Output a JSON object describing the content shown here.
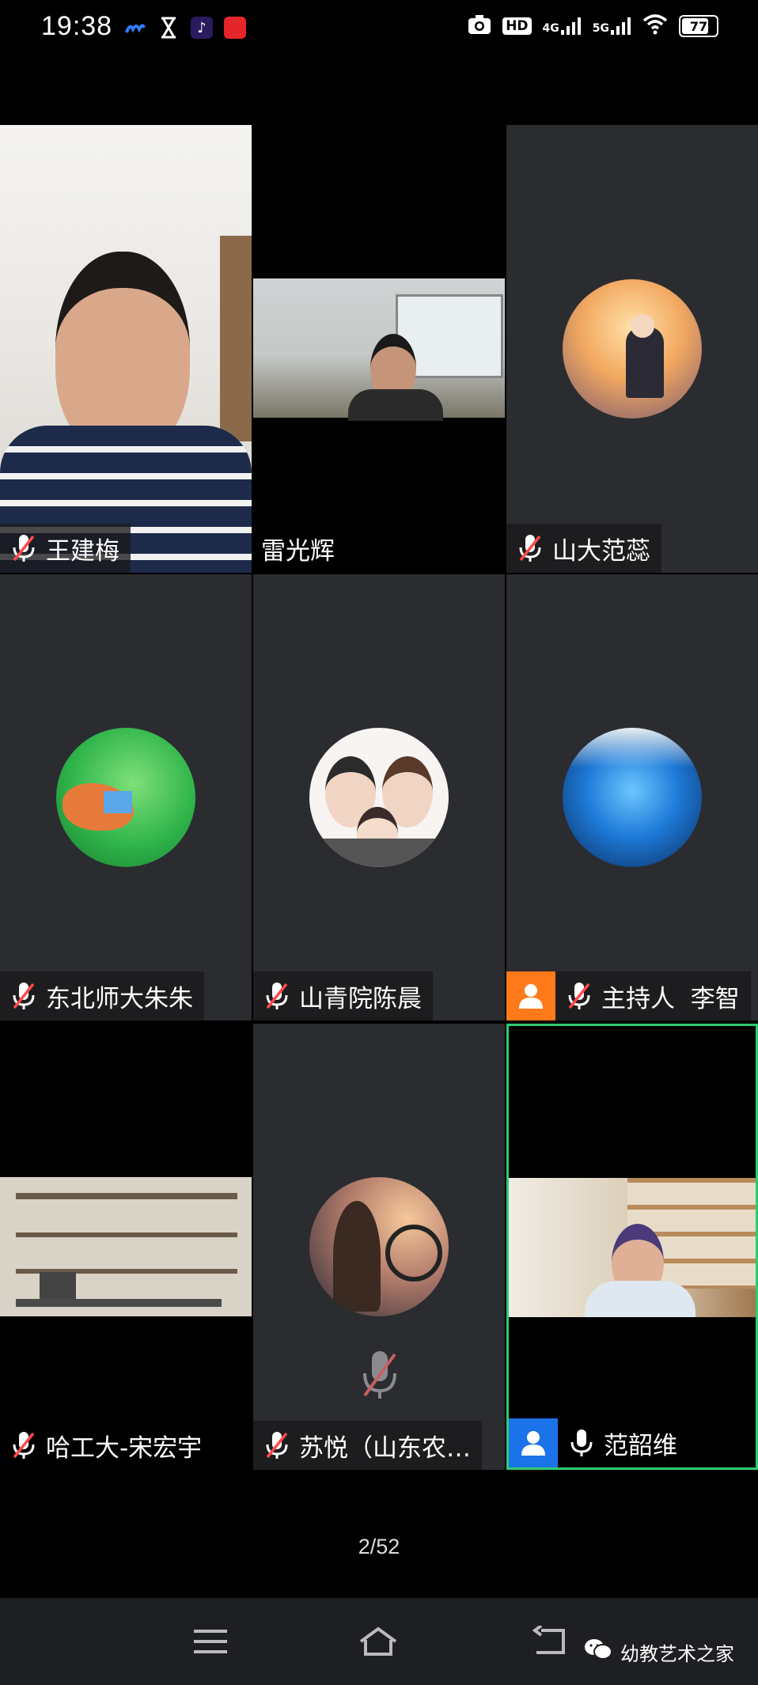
{
  "status_bar": {
    "time": "19:38",
    "hd_label": "HD",
    "net1": "4G",
    "net2": "5G",
    "battery": "77"
  },
  "participants": [
    {
      "name": "王建梅",
      "muted": true,
      "video": "camera"
    },
    {
      "name": "雷光辉",
      "muted": null,
      "video": "camera"
    },
    {
      "name": "山大范蕊",
      "muted": true,
      "video": "avatar"
    },
    {
      "name": "东北师大朱朱",
      "muted": true,
      "video": "avatar"
    },
    {
      "name": "山青院陈晨",
      "muted": true,
      "video": "avatar"
    },
    {
      "name": "主持人  李智",
      "muted": true,
      "video": "avatar",
      "host": true
    },
    {
      "name": "哈工大-宋宏宇",
      "muted": true,
      "video": "camera"
    },
    {
      "name": "苏悦（山东农…",
      "muted": true,
      "video": "avatar"
    },
    {
      "name": "范韶维",
      "muted": false,
      "video": "camera",
      "active_speaker": true
    }
  ],
  "pager": "2/52",
  "watermark": "幼教艺术之家",
  "colors": {
    "tile_bg": "#2b2c30",
    "active_border": "#2ecc71",
    "host_badge": "#ff7a1a",
    "self_badge": "#1a73e8",
    "mute_slash": "#ff4a4a"
  }
}
